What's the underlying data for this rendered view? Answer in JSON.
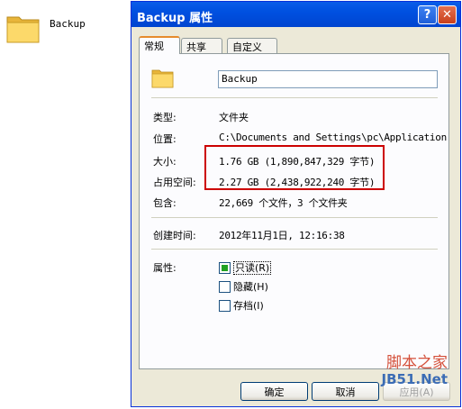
{
  "desktop": {
    "folder_label": "Backup"
  },
  "window": {
    "title": "Backup 属性",
    "help_label": "?",
    "close_label": "✕"
  },
  "tabs": [
    {
      "label": "常规"
    },
    {
      "label": "共享"
    },
    {
      "label": "自定义"
    }
  ],
  "general": {
    "name_value": "Backup",
    "type_label": "类型:",
    "type_value": "文件夹",
    "location_label": "位置:",
    "location_value": "C:\\Documents and Settings\\pc\\Application",
    "size_label": "大小:",
    "size_value": "1.76 GB (1,890,847,329 字节)",
    "disk_size_label": "占用空间:",
    "disk_size_value": "2.27 GB (2,438,922,240 字节)",
    "contains_label": "包含:",
    "contains_value": "22,669 个文件，3 个文件夹",
    "created_label": "创建时间:",
    "created_value": "2012年11月1日, 12:16:38",
    "attributes_label": "属性:",
    "attributes": [
      {
        "label": "只读(R)",
        "checked": true
      },
      {
        "label": "隐藏(H)",
        "checked": false
      },
      {
        "label": "存档(I)",
        "checked": false
      }
    ]
  },
  "buttons": {
    "ok": "确定",
    "cancel": "取消",
    "apply": "应用(A)"
  },
  "watermark": {
    "line1": "脚本之家",
    "line2": "JB51.Net"
  },
  "colors": {
    "title_blue": "#0050e0",
    "highlight_red": "#cc0000",
    "window_bg": "#ece9d8"
  }
}
